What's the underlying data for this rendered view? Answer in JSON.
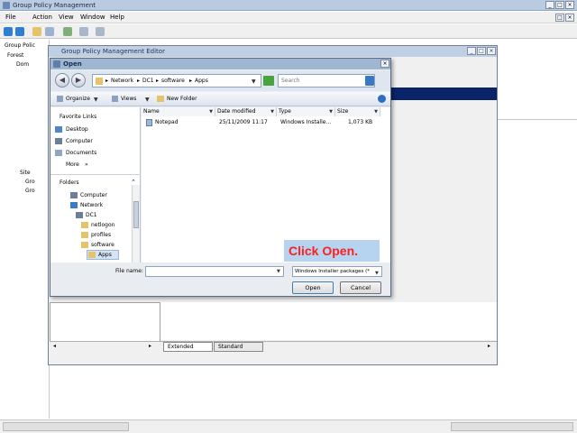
{
  "gpm": {
    "title": "Group Policy Management",
    "menu": [
      "File",
      "Action",
      "View",
      "Window",
      "Help"
    ],
    "tree_labels": [
      "Group Polic",
      "Forest",
      "Dom",
      "Site",
      "Gro",
      "Gro"
    ]
  },
  "editor": {
    "title": "Group Policy Management Editor"
  },
  "dialog": {
    "title": "Open",
    "breadcrumb": [
      "Network",
      "DC1",
      "software",
      "Apps"
    ],
    "search_placeholder": "Search",
    "cmd": {
      "organize": "Organize",
      "views": "Views",
      "new_folder": "New Folder"
    },
    "nav": {
      "favorites": "Favorite Links",
      "links": [
        "Desktop",
        "Computer",
        "Documents"
      ],
      "more": "More",
      "folders_header": "Folders",
      "folders": [
        "Computer",
        "Network",
        "DC1",
        "netlogon",
        "profiles",
        "software",
        "Apps"
      ]
    },
    "columns": [
      "Name",
      "Date modified",
      "Type",
      "Size"
    ],
    "files": [
      {
        "name": "Notepad",
        "date": "25/11/2009 11:17",
        "type": "Windows Installe...",
        "size": "1,073 KB"
      }
    ],
    "filename_label": "File name:",
    "filename_value": "",
    "filetype_selected": "Windows Installer packages (*",
    "open_label": "Open",
    "cancel_label": "Cancel"
  },
  "tabs": {
    "extended": "Extended",
    "standard": "Standard"
  },
  "callout": "Click Open.",
  "colors": {
    "accent": "#0a246a",
    "callout_text": "#ff1f1f",
    "callout_bg": "#b6d3ef"
  }
}
